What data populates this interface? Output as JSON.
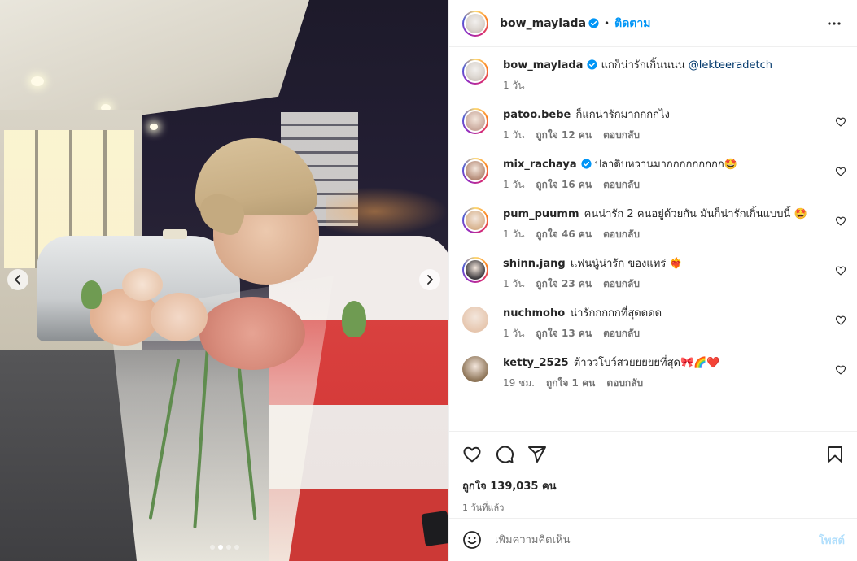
{
  "post": {
    "author": "bow_maylada",
    "follow_sep": "•",
    "follow_label": "ติดตาม",
    "caption_text": "แกก็น่ารักเกิ้นนนน",
    "caption_mention": "@lekteeradetch",
    "caption_time": "1 วัน"
  },
  "comments": [
    {
      "user": "patoo.bebe",
      "verified": false,
      "text": "ก็แกน่ารักมากกกกไง",
      "time": "1 วัน",
      "likes": "ถูกใจ 12 คน",
      "reply": "ตอบกลับ",
      "avatar_color": "#c9a89b"
    },
    {
      "user": "mix_rachaya",
      "verified": true,
      "text": "ปลาดิบหวานมากกกกกกกกก🤩",
      "time": "1 วัน",
      "likes": "ถูกใจ 16 คน",
      "reply": "ตอบกลับ",
      "avatar_color": "#b48a76"
    },
    {
      "user": "pum_puumm",
      "verified": false,
      "text": "คนน่ารัก 2 คนอยู่ด้วยกัน มันก็น่ารักเกิ้นแบบนี้ 🤩",
      "time": "1 วัน",
      "likes": "ถูกใจ 46 คน",
      "reply": "ตอบกลับ",
      "avatar_color": "#d7b28d"
    },
    {
      "user": "shinn.jang",
      "verified": false,
      "text": "แฟนนู๋น่ารัก ของแทร่ ❤️‍🔥",
      "time": "1 วัน",
      "likes": "ถูกใจ 23 คน",
      "reply": "ตอบกลับ",
      "avatar_color": "#3d3a3e"
    },
    {
      "user": "nuchmoho",
      "verified": false,
      "text": "น่ารักกกกกที่สุดดดด",
      "time": "1 วัน",
      "likes": "ถูกใจ 13 คน",
      "reply": "ตอบกลับ",
      "avatar_color": "#e6c6ae"
    },
    {
      "user": "ketty_2525",
      "verified": false,
      "text": "ต้าววโบว์สวยยยยยที่สุด🎀🌈❤️",
      "time": "19 ชม.",
      "likes": "ถูกใจ 1 คน",
      "reply": "ตอบกลับ",
      "avatar_color": "#8c7356"
    }
  ],
  "stats": {
    "likes": "ถูกใจ 139,035 คน",
    "ago": "1 วันที่แล้ว"
  },
  "composer": {
    "placeholder": "เพิ่มความคิดเห็น",
    "post_label": "โพสต์"
  },
  "carousel": {
    "slide_count": 4,
    "active_index": 1
  },
  "colors": {
    "link": "#0095f6",
    "mention": "#00376b",
    "muted": "#737373",
    "post_disabled": "#b2dffc"
  },
  "icons": [
    "chevron-left-icon",
    "chevron-right-icon",
    "verified-icon",
    "more-icon",
    "heart-icon",
    "comment-icon",
    "share-icon",
    "bookmark-icon",
    "emoji-icon"
  ]
}
